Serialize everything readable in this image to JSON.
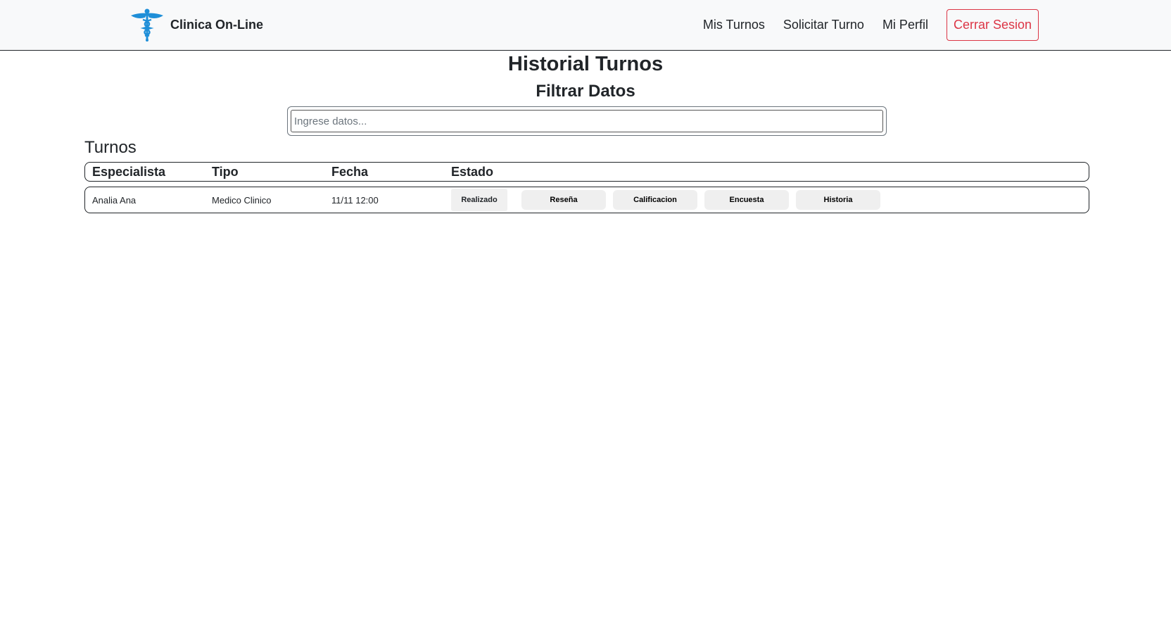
{
  "brand": {
    "name": "Clinica On-Line",
    "logo_icon": "caduceus-icon",
    "logo_color": "#1f8fd8"
  },
  "nav": {
    "links": [
      "Mis Turnos",
      "Solicitar Turno",
      "Mi Perfil"
    ],
    "logout_label": "Cerrar Sesion",
    "logout_color": "#dc3545"
  },
  "page": {
    "title": "Historial Turnos",
    "filter_title": "Filtrar Datos",
    "search_placeholder": "Ingrese datos...",
    "section_title": "Turnos"
  },
  "table": {
    "headers": [
      "Especialista",
      "Tipo",
      "Fecha",
      "Estado"
    ],
    "rows": [
      {
        "especialista": "Analia Ana",
        "tipo": "Medico Clinico",
        "fecha": "11/11 12:00",
        "estado": "Realizado",
        "actions": [
          "Reseña",
          "Calificacion",
          "Encuesta",
          "Historia"
        ]
      }
    ]
  }
}
